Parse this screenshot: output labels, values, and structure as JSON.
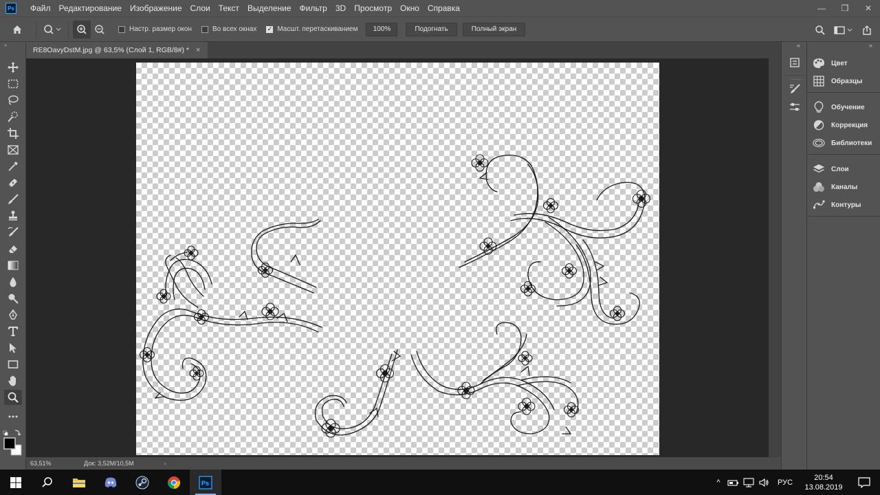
{
  "app": {
    "logo_text": "Ps",
    "accent": "#31a8ff"
  },
  "menu": {
    "items": [
      "Файл",
      "Редактирование",
      "Изображение",
      "Слои",
      "Текст",
      "Выделение",
      "Фильтр",
      "3D",
      "Просмотр",
      "Окно",
      "Справка"
    ]
  },
  "window_controls": {
    "minimize": "—",
    "restore": "❐",
    "close": "✕"
  },
  "options_bar": {
    "resize_windows_label": "Настр. размер окон",
    "resize_windows_checked": false,
    "all_windows_label": "Во всех окнах",
    "all_windows_checked": false,
    "scrubby_zoom_label": "Масшт. перетаскиванием",
    "scrubby_zoom_checked": true,
    "zoom_value": "100%",
    "fit_button": "Подогнать",
    "fullscreen_button": "Полный экран"
  },
  "document_tab": {
    "title": "RE8OavyDstM.jpg @ 63,5% (Слой 1, RGB/8#) *",
    "close": "×"
  },
  "status_bar": {
    "zoom": "63,51%",
    "doc_size": "Док: 3,52M/10,5M",
    "arrow": "›"
  },
  "panels": {
    "group1": [
      {
        "label": "Цвет",
        "icon": "color-palette-icon"
      },
      {
        "label": "Образцы",
        "icon": "swatches-grid-icon"
      }
    ],
    "group2": [
      {
        "label": "Обучение",
        "icon": "lightbulb-icon"
      },
      {
        "label": "Коррекция",
        "icon": "adjustments-icon"
      },
      {
        "label": "Библиотеки",
        "icon": "libraries-cloud-icon"
      }
    ],
    "group3": [
      {
        "label": "Слои",
        "icon": "layers-icon"
      },
      {
        "label": "Каналы",
        "icon": "channels-icon"
      },
      {
        "label": "Контуры",
        "icon": "paths-icon"
      }
    ]
  },
  "tools": [
    "move-tool-icon",
    "marquee-tool-icon",
    "lasso-tool-icon",
    "quick-select-tool-icon",
    "crop-tool-icon",
    "frame-tool-icon",
    "eyedropper-tool-icon",
    "healing-brush-tool-icon",
    "brush-tool-icon",
    "stamp-tool-icon",
    "history-brush-tool-icon",
    "eraser-tool-icon",
    "gradient-tool-icon",
    "blur-tool-icon",
    "dodge-tool-icon",
    "pen-tool-icon",
    "type-tool-icon",
    "path-select-tool-icon",
    "rectangle-tool-icon",
    "hand-tool-icon",
    "zoom-tool-icon",
    "more-tools-icon"
  ],
  "colors": {
    "foreground": "#000000",
    "background": "#ffffff"
  },
  "taskbar": {
    "apps": [
      "start-icon",
      "search-icon",
      "file-explorer-icon",
      "discord-icon",
      "steam-icon",
      "chrome-icon",
      "photoshop-icon"
    ],
    "active_app": "photoshop-icon",
    "tray_arrow": "^",
    "language": "РУС",
    "time": "20:54",
    "date": "13.08.2019"
  }
}
